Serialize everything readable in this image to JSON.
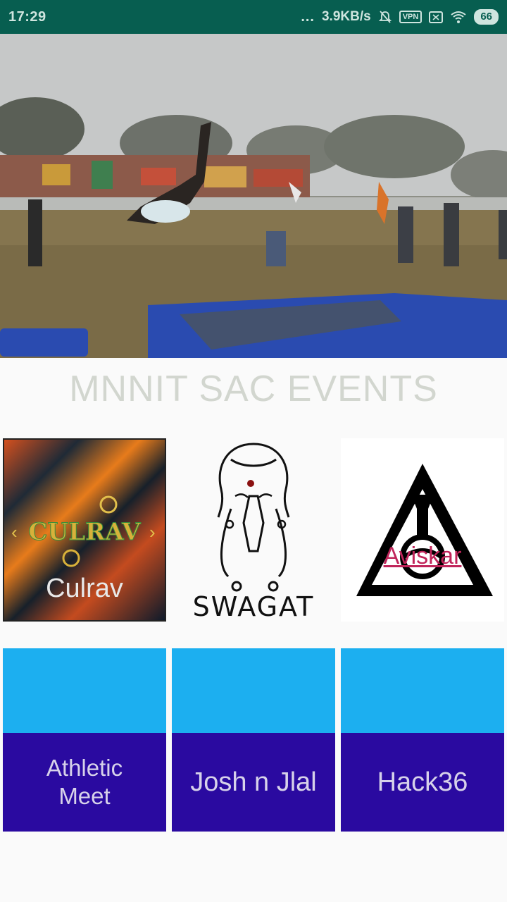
{
  "status_bar": {
    "time": "17:29",
    "dots": "...",
    "speed": "3.9KB/s",
    "vpn": "VPN",
    "battery": "66"
  },
  "page_title": "MNNIT SAC EVENTS",
  "logo_tiles": [
    {
      "id": "culrav",
      "label": "Culrav",
      "logo_text": "CULRAV"
    },
    {
      "id": "swagat",
      "label": "SWAGAT"
    },
    {
      "id": "aviskar",
      "label": "Aviskar"
    }
  ],
  "event_cards": [
    {
      "id": "athletic",
      "label": "Athletic Meet"
    },
    {
      "id": "josh",
      "label": "Josh n Jlal"
    },
    {
      "id": "hack36",
      "label": "Hack36"
    }
  ],
  "colors": {
    "status_bar": "#075e50",
    "card_top": "#1caff0",
    "card_bottom": "#2a0aa0",
    "title": "#d2d6cf"
  }
}
